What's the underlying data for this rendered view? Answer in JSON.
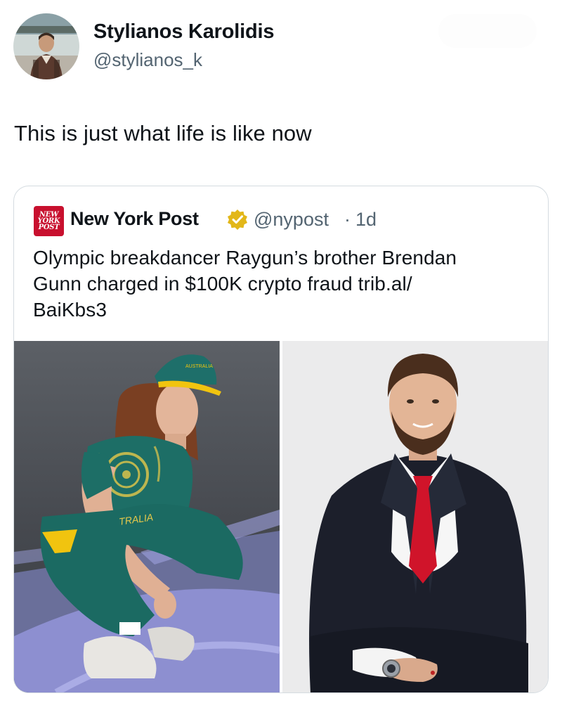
{
  "post": {
    "author_name": "Stylianos Karolidis",
    "author_handle": "@stylianos_k",
    "text": "This is just what life is like now"
  },
  "quote": {
    "logo_lines": [
      "NEW",
      "YORK",
      "POST"
    ],
    "author_name": "New York Post",
    "verified_icon": "verified-gold-badge-icon",
    "author_handle": "@nypost",
    "separator": "·",
    "time": "1d",
    "text_lines": [
      "Olympic breakdancer Raygun’s brother Brendan",
      "Gunn charged in $100K crypto fraud trib.al/",
      "BaiKbs3"
    ],
    "images": [
      {
        "name": "breakdancer-photo",
        "cap_text": "AUSTRALIA",
        "pants_text": "TRALIA"
      },
      {
        "name": "man-in-suit-photo"
      }
    ]
  },
  "colors": {
    "text": "#0f1419",
    "secondary": "#536471",
    "border": "#d4dbe0",
    "nypost_red": "#c8102e",
    "verified_gold": "#e2b719",
    "uniform_green": "#1d6e66",
    "uniform_yellow": "#f1c40f",
    "tie_red": "#d0142a"
  }
}
